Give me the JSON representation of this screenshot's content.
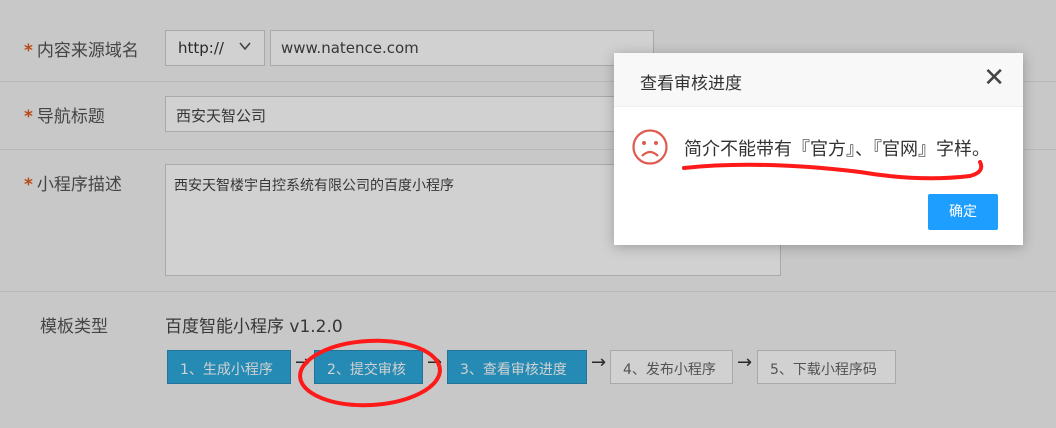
{
  "form": {
    "domain": {
      "label": "内容来源域名",
      "protocol": "http://",
      "value": "www.natence.com"
    },
    "nav_title": {
      "label": "导航标题",
      "value": "西安天智公司"
    },
    "description": {
      "label": "小程序描述",
      "value": "西安天智楼宇自控系统有限公司的百度小程序"
    },
    "template": {
      "label": "模板类型",
      "value": "百度智能小程序 v1.2.0"
    },
    "required_mark": "*"
  },
  "steps": [
    {
      "label": "1、生成小程序",
      "state": "active"
    },
    {
      "label": "2、提交审核",
      "state": "active"
    },
    {
      "label": "3、查看审核进度",
      "state": "active"
    },
    {
      "label": "4、发布小程序",
      "state": "inactive"
    },
    {
      "label": "5、下载小程序码",
      "state": "inactive"
    }
  ],
  "step_arrow": "→",
  "dialog": {
    "title": "查看审核进度",
    "close_symbol": "✕",
    "message": "简介不能带有『官方』、『官网』字样。",
    "confirm_label": "确定",
    "icon": "sad-face-icon"
  },
  "colors": {
    "accent": "#2eaadc",
    "primary_button": "#1e9fff",
    "required": "#e0591c",
    "annotation": "#ff1a1a",
    "icon": "#e05a4f"
  }
}
